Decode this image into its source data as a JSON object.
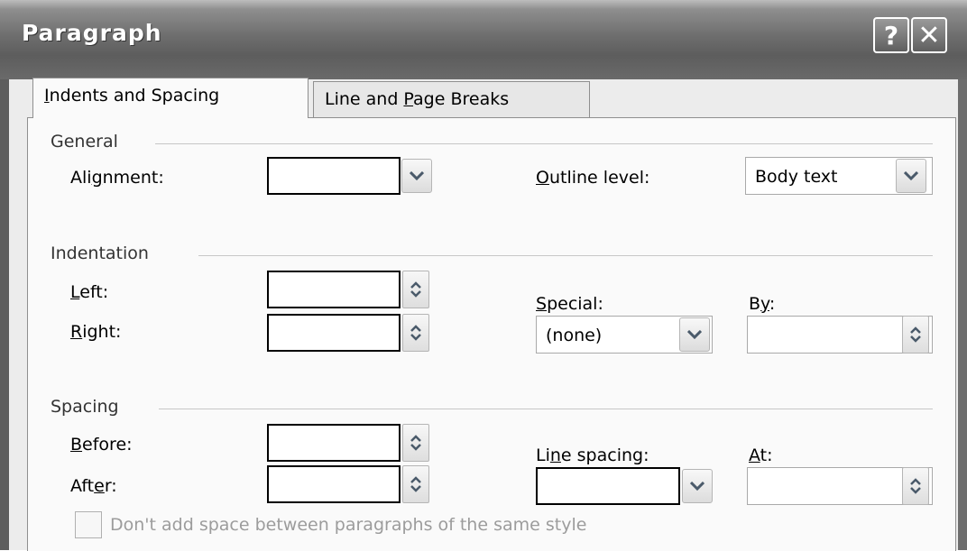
{
  "window": {
    "title": "Paragraph"
  },
  "titlebar_buttons": {
    "help": "?",
    "close": "✕"
  },
  "tabs": [
    {
      "label_pre": "",
      "mnemonic": "I",
      "label_post": "ndents and Spacing",
      "active": true
    },
    {
      "label_pre": "Line and ",
      "mnemonic": "P",
      "label_post": "age Breaks",
      "active": false
    }
  ],
  "general": {
    "group_label": "General",
    "alignment": {
      "pre": "Ali",
      "mn": "g",
      "post": "nment:",
      "value": ""
    },
    "outline_level": {
      "pre": "",
      "mn": "O",
      "post": "utline level:",
      "value": "Body text"
    }
  },
  "indentation": {
    "group_label": "Indentation",
    "left": {
      "pre": "",
      "mn": "L",
      "post": "eft:",
      "value": ""
    },
    "right": {
      "pre": "",
      "mn": "R",
      "post": "ight:",
      "value": ""
    },
    "special": {
      "pre": "",
      "mn": "S",
      "post": "pecial:",
      "value": "(none)"
    },
    "by": {
      "pre": "B",
      "mn": "y",
      "post": ":",
      "value": ""
    }
  },
  "spacing": {
    "group_label": "Spacing",
    "before": {
      "pre": "",
      "mn": "B",
      "post": "efore:",
      "value": ""
    },
    "after": {
      "pre": "Aft",
      "mn": "e",
      "post": "r:",
      "value": ""
    },
    "line_spacing": {
      "pre": "Li",
      "mn": "n",
      "post": "e spacing:",
      "value": ""
    },
    "at": {
      "pre": "",
      "mn": "A",
      "post": "t:",
      "value": ""
    },
    "dont_add_space": {
      "label": "Don't add space between paragraphs of the same style",
      "checked": false
    }
  },
  "icons": {
    "dropdown": "chevron-down-icon",
    "spinner": "spinner-updown-icon",
    "help": "question-icon",
    "close": "close-icon"
  }
}
